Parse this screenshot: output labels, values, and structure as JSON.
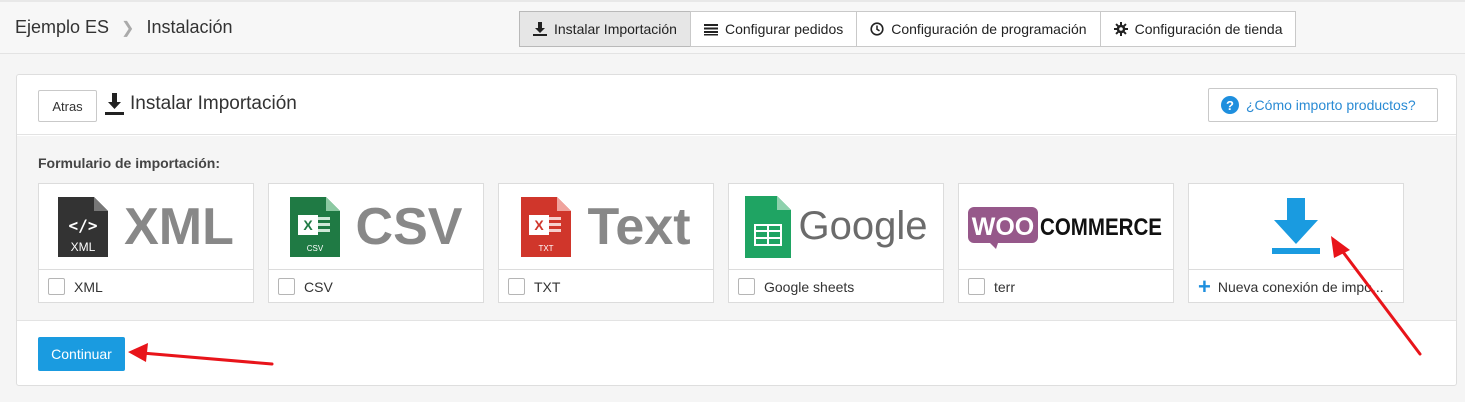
{
  "header": {
    "breadcrumb": [
      "Ejemplo ES",
      "Instalación"
    ],
    "tabs": [
      {
        "label": "Instalar Importación",
        "icon": "download-icon",
        "active": true
      },
      {
        "label": "Configurar pedidos",
        "icon": "list-icon",
        "active": false
      },
      {
        "label": "Configuración de programación",
        "icon": "clock-icon",
        "active": false
      },
      {
        "label": "Configuración de tienda",
        "icon": "gear-icon",
        "active": false
      }
    ]
  },
  "panel": {
    "back_label": "Atras",
    "title": "Instalar Importación",
    "help_label": "¿Cómo importo productos?",
    "form_label": "Formulario de importación:",
    "cards": [
      {
        "logo_text": "XML",
        "file_tag": "XML",
        "label": "XML",
        "icon": "xml-file-icon"
      },
      {
        "logo_text": "CSV",
        "file_tag": "CSV",
        "label": "CSV",
        "icon": "csv-file-icon"
      },
      {
        "logo_text": "Text",
        "file_tag": "TXT",
        "label": "TXT",
        "icon": "txt-file-icon"
      },
      {
        "logo_text": "Google",
        "label": "Google sheets",
        "icon": "google-sheets-icon"
      },
      {
        "logo_text_1": "WOO",
        "logo_text_2": "COMMERCE",
        "label": "terr",
        "icon": "woocommerce-logo"
      },
      {
        "label": "Nueva conexión de impo...",
        "icon": "download-icon"
      }
    ],
    "continue_label": "Continuar"
  },
  "colors": {
    "primary": "#1a9be0",
    "link": "#2a8bd4",
    "xml": "#333333",
    "csv": "#1f7a44",
    "txt": "#d0362b",
    "sheets": "#1fa463",
    "woo": "#96588a",
    "annotation_arrow": "#e8141a"
  }
}
